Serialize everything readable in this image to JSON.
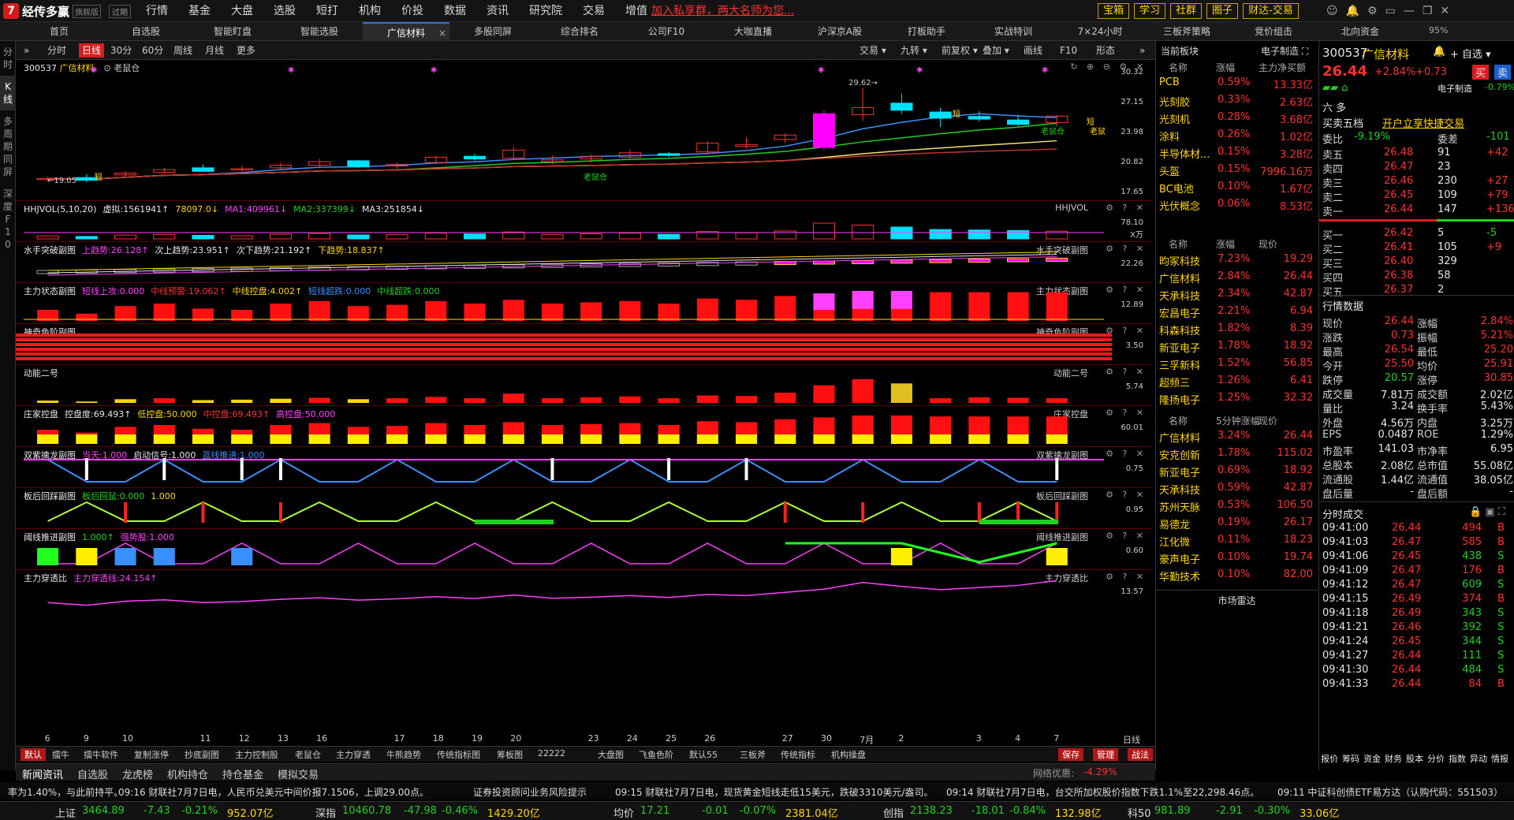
{
  "app": {
    "logo_mark": "7",
    "name": "经传多赢",
    "edition": "旗舰版",
    "expiry": "过期"
  },
  "menu": [
    "行情",
    "基金",
    "大盘",
    "选股",
    "短打",
    "机构",
    "价投",
    "数据",
    "资讯",
    "研究院",
    "交易",
    "增值"
  ],
  "promo": "加入私享群，两大名师为您...",
  "right_buttons": [
    "宝箱",
    "学习",
    "社群",
    "圈子",
    "财达-交易"
  ],
  "window_icons": [
    "☺",
    "🔔",
    "⚙",
    "▭",
    "—",
    "❐",
    "✕"
  ],
  "tabs": [
    "首页",
    "自选股",
    "智能盯盘",
    "智能选股",
    "广信材料",
    "多股同屏",
    "综合排名",
    "公司F10",
    "大咖直播",
    "沪深京A股",
    "打板助手",
    "实战特训",
    "7×24小时",
    "三板斧策略",
    "竞价组击",
    "北向资金"
  ],
  "zoom": "95%",
  "left_side": [
    "分时",
    "K线",
    "多周期同屏",
    "深度F10"
  ],
  "chart_toolbar": {
    "left": [
      "分时",
      "日线",
      "30分",
      "60分",
      "周线",
      "月线",
      "更多"
    ],
    "right": [
      "交易",
      "九转",
      "前复权",
      "叠加",
      "画线",
      "F10",
      "形态"
    ]
  },
  "stock": {
    "code": "300537",
    "name": "广信材料",
    "tag": "老鼠仓"
  },
  "main_chart": {
    "scale": [
      "30.32",
      "27.15",
      "23.98",
      "20.82",
      "17.65"
    ],
    "low_label": "19.05",
    "high_label": "29.62",
    "marks": [
      "短",
      "老鼠仓",
      "短",
      "老鼠仓",
      "短",
      "老鼠"
    ]
  },
  "panes": [
    {
      "name": "HHJVOL",
      "items": [
        [
          "HHJVOL(5,10,20)",
          "w"
        ],
        [
          "虚拟:1561941↑",
          "w"
        ],
        [
          "78097.0↓",
          "y"
        ],
        [
          "MA1:409961↓",
          "m"
        ],
        [
          "MA2:337399↓",
          "g"
        ],
        [
          "MA3:251854↓",
          "w"
        ]
      ],
      "right": "HHJVOL",
      "scale": [
        "78.10",
        "X万"
      ]
    },
    {
      "name": "水手突破副图",
      "items": [
        [
          "水手突破副图",
          "w"
        ],
        [
          "上趋势:26.128↑",
          "m"
        ],
        [
          "次上趋势:23.951↑",
          "w"
        ],
        [
          "次下趋势:21.192↑",
          "w"
        ],
        [
          "下趋势:18.837↑",
          "y"
        ]
      ],
      "right": "水手突破副图",
      "scale": [
        "22.26"
      ]
    },
    {
      "name": "主力状态副图",
      "items": [
        [
          "主力状态副图",
          "w"
        ],
        [
          "短线上攻:0.000",
          "m"
        ],
        [
          "中线预警:19.062↑",
          "r"
        ],
        [
          "中线控盘:4.002↑",
          "y"
        ],
        [
          "短线超跌:0.000",
          "b"
        ],
        [
          "中线超跌:0.000",
          "g"
        ]
      ],
      "right": "主力状态副图",
      "scale": [
        "12.89"
      ]
    },
    {
      "name": "神奇色阶副图",
      "items": [
        [
          "神奇色阶副图",
          "w"
        ]
      ],
      "right": "神奇色阶副图",
      "scale": [
        "3.50"
      ]
    },
    {
      "name": "动能二号",
      "items": [
        [
          "动能二号",
          "w"
        ]
      ],
      "right": "动能二号",
      "scale": [
        "5.74"
      ]
    },
    {
      "name": "庄家控盘",
      "items": [
        [
          "庄家控盘",
          "w"
        ],
        [
          "控盘度:69.493↑",
          "w"
        ],
        [
          "低控盘:50.000",
          "y"
        ],
        [
          "中控盘:69.493↑",
          "r"
        ],
        [
          "高控盘:50.000",
          "m"
        ]
      ],
      "right": "庄家控盘",
      "scale": [
        "60.01"
      ]
    },
    {
      "name": "双紫擒龙副图",
      "items": [
        [
          "双紫擒龙副图",
          "w"
        ],
        [
          "当天:1.000",
          "m"
        ],
        [
          "启动信号:1.000",
          "w"
        ],
        [
          "蓝线推进:1.000",
          "b"
        ]
      ],
      "right": "双紫擒龙副图",
      "scale": [
        "0.75"
      ]
    },
    {
      "name": "板后回踩副图",
      "items": [
        [
          "板后回踩副图",
          "w"
        ],
        [
          "板后回鼠:0.000",
          "g"
        ],
        [
          "1.000",
          "y"
        ]
      ],
      "right": "板后回踩副图",
      "scale": [
        "0.95"
      ]
    },
    {
      "name": "阈线推进副图",
      "items": [
        [
          "阈线推进副图",
          "w"
        ],
        [
          "1.000↑",
          "g"
        ],
        [
          "强势股:1.000",
          "m"
        ]
      ],
      "right": "阈线推进副图",
      "scale": [
        "0.60"
      ]
    },
    {
      "name": "主力穿透比",
      "items": [
        [
          "主力穿透比",
          "w"
        ],
        [
          "主力穿透线:24.154↑",
          "m"
        ]
      ],
      "right": "主力穿透比",
      "scale": [
        "13.57"
      ]
    }
  ],
  "x_axis": [
    "6",
    "9",
    "10",
    "11",
    "12",
    "13",
    "16",
    "17",
    "18",
    "19",
    "20",
    "23",
    "24",
    "25",
    "26",
    "27",
    "30",
    "7月",
    "2",
    "3",
    "4",
    "7"
  ],
  "x_axis_right": "日线",
  "bottom_tabs": [
    "默认",
    "擂牛",
    "擂牛软件",
    "复制涨停",
    "抄底副图",
    "主力控制股",
    "老鼠仓",
    "主力穿透",
    "牛熊趋势",
    "传统指标图",
    "筹板图",
    "22222",
    "大盘图",
    "飞鱼色阶",
    "默认55",
    "三板斧",
    "传统指标",
    "机构操盘"
  ],
  "bottom_right": [
    "保存",
    "管理",
    "战法"
  ],
  "news_tabs": [
    "新闻资讯",
    "自选股",
    "龙虎榜",
    "机构持仓",
    "持仓基金",
    "模拟交易"
  ],
  "network": "网络优惠:",
  "network_val": "-4.29%",
  "ticker": [
    "率为1.40%，与此前持平。",
    "09:16 财联社7月7日电，人民币兑美元中间价报7.1506，上调29.00点。",
    "证券投资顾问业务风险提示",
    "09:15 财联社7月7日电，现货黄金短线走低15美元，跌破3310美元/盎司。",
    "09:14 财联社7月7日电，台交所加权股价指数下跌1.1%至22,298.46点。",
    "09:11 中证科创债ETF易方达（认购代码：551503）"
  ],
  "indices": [
    {
      "name": "上证",
      "val": "3464.89",
      "chg": "-7.43",
      "pct": "-0.21%",
      "amt": "952.07亿"
    },
    {
      "name": "深指",
      "val": "10460.78",
      "chg": "-47.98",
      "pct": "-0.46%",
      "amt": "1429.20亿"
    },
    {
      "name": "均价",
      "val": "17.21",
      "chg": "-0.01",
      "pct": "-0.07%",
      "amt": "2381.04亿"
    },
    {
      "name": "创指",
      "val": "2138.23",
      "chg": "-18.01",
      "pct": "-0.84%",
      "amt": "132.98亿"
    },
    {
      "name": "科50",
      "val": "981.89",
      "chg": "-2.91",
      "pct": "-0.30%",
      "amt": "33.06亿"
    }
  ],
  "sector_block": {
    "title": "当前板块",
    "tag": "电子制造",
    "head": [
      "名称",
      "涨幅",
      "主力净买额"
    ],
    "rows": [
      [
        "PCB",
        "0.59%",
        "13.33亿"
      ],
      [
        "光刻胶",
        "0.33%",
        "2.63亿"
      ],
      [
        "光刻机",
        "0.28%",
        "3.68亿"
      ],
      [
        "涂料",
        "0.26%",
        "1.02亿"
      ],
      [
        "半导体材...",
        "0.15%",
        "3.28亿"
      ],
      [
        "头盔",
        "0.15%",
        "7996.16万"
      ],
      [
        "BC电池",
        "0.10%",
        "1.67亿"
      ],
      [
        "光伏概念",
        "0.06%",
        "8.53亿"
      ]
    ]
  },
  "sector_list2": {
    "head": [
      "名称",
      "涨幅",
      "现价"
    ],
    "rows": [
      [
        "昀冢科技",
        "7.23%",
        "19.29"
      ],
      [
        "广信材料",
        "2.84%",
        "26.44"
      ],
      [
        "天承科技",
        "2.34%",
        "42.87"
      ],
      [
        "宏昌电子",
        "2.21%",
        "6.94"
      ],
      [
        "科森科技",
        "1.82%",
        "8.39"
      ],
      [
        "新亚电子",
        "1.78%",
        "18.92"
      ],
      [
        "三孚新科",
        "1.52%",
        "56.85"
      ],
      [
        "超频三",
        "1.26%",
        "6.41"
      ],
      [
        "隆扬电子",
        "1.25%",
        "32.32"
      ]
    ]
  },
  "sector_list3": {
    "head": [
      "名称",
      "5分钟涨幅",
      "现价"
    ],
    "rows": [
      [
        "广信材料",
        "3.24%",
        "26.44"
      ],
      [
        "安克创新",
        "1.78%",
        "115.02"
      ],
      [
        "新亚电子",
        "0.69%",
        "18.92"
      ],
      [
        "天承科技",
        "0.59%",
        "42.87"
      ],
      [
        "苏州天脉",
        "0.53%",
        "106.50"
      ],
      [
        "易德龙",
        "0.19%",
        "26.17"
      ],
      [
        "江化微",
        "0.11%",
        "18.23"
      ],
      [
        "豪声电子",
        "0.10%",
        "19.74"
      ],
      [
        "华勤技术",
        "0.10%",
        "82.00"
      ]
    ]
  },
  "sector_footer": "市场雷达",
  "quote": {
    "code": "300537",
    "name": "广信材料",
    "price": "26.44",
    "pct": "+2.84%",
    "chg": "+0.73",
    "sector": "电子制造",
    "sector_pct": "-0.79%",
    "buy_btn": "买",
    "sell_btn": "卖",
    "watch_btn": "自选",
    "five_title": "买卖五档",
    "trade_link": "开户立享快捷交易",
    "wb_label": "委比",
    "wb_val": "-9.19%",
    "wc_label": "委差",
    "wc_val": "-101",
    "asks": [
      [
        "卖五",
        "26.48",
        "91",
        "+42"
      ],
      [
        "卖四",
        "26.47",
        "23",
        ""
      ],
      [
        "卖三",
        "26.46",
        "230",
        "+27"
      ],
      [
        "卖二",
        "26.45",
        "109",
        "+79"
      ],
      [
        "卖一",
        "26.44",
        "147",
        "+136"
      ]
    ],
    "bids": [
      [
        "买一",
        "26.42",
        "5",
        "-5"
      ],
      [
        "买二",
        "26.41",
        "105",
        "+9"
      ],
      [
        "买三",
        "26.40",
        "329",
        ""
      ],
      [
        "买四",
        "26.38",
        "58",
        ""
      ],
      [
        "买五",
        "26.37",
        "2",
        ""
      ]
    ],
    "data_title": "行情数据",
    "stats": [
      [
        "现价",
        "26.44",
        "涨幅",
        "2.84%"
      ],
      [
        "涨跌",
        "0.73",
        "振幅",
        "5.21%"
      ],
      [
        "最高",
        "26.54",
        "最低",
        "25.20"
      ],
      [
        "今开",
        "25.50",
        "均价",
        "25.91"
      ],
      [
        "跌停",
        "20.57",
        "涨停",
        "30.85"
      ],
      [
        "成交量",
        "7.81万",
        "成交额",
        "2.02亿"
      ],
      [
        "量比",
        "3.24",
        "换手率",
        "5.43%"
      ],
      [
        "外盘",
        "4.56万",
        "内盘",
        "3.25万"
      ],
      [
        "EPS",
        "0.0487",
        "ROE",
        "1.29%"
      ],
      [
        "市盈率",
        "141.03",
        "市净率",
        "6.95"
      ],
      [
        "总股本",
        "2.08亿",
        "总市值",
        "55.08亿"
      ],
      [
        "流通股",
        "1.44亿",
        "流通值",
        "38.05亿"
      ],
      [
        "盘后量",
        "-",
        "盘后额",
        "-"
      ]
    ],
    "ticks_title": "分时成交",
    "ticks": [
      [
        "09:41:00",
        "26.44",
        "494",
        "B"
      ],
      [
        "09:41:03",
        "26.47",
        "585",
        "B"
      ],
      [
        "09:41:06",
        "26.45",
        "438",
        "S"
      ],
      [
        "09:41:09",
        "26.47",
        "176",
        "B"
      ],
      [
        "09:41:12",
        "26.47",
        "609",
        "S"
      ],
      [
        "09:41:15",
        "26.49",
        "374",
        "B"
      ],
      [
        "09:41:18",
        "26.49",
        "343",
        "S"
      ],
      [
        "09:41:21",
        "26.46",
        "392",
        "S"
      ],
      [
        "09:41:24",
        "26.45",
        "344",
        "S"
      ],
      [
        "09:41:27",
        "26.44",
        "111",
        "S"
      ],
      [
        "09:41:30",
        "26.44",
        "484",
        "S"
      ],
      [
        "09:41:33",
        "26.44",
        "84",
        "B"
      ]
    ],
    "footer_tabs": [
      "报价",
      "筹码",
      "资金",
      "财务",
      "股本",
      "分价",
      "指数",
      "异动",
      "情报"
    ]
  },
  "candles": [
    [
      19.3,
      19.6,
      19.1,
      19.4
    ],
    [
      19.5,
      19.9,
      19.0,
      19.2
    ],
    [
      19.8,
      20.2,
      19.6,
      20.0
    ],
    [
      20.1,
      20.6,
      19.9,
      20.4
    ],
    [
      20.6,
      21.0,
      20.3,
      20.2
    ],
    [
      20.5,
      20.8,
      20.2,
      20.5
    ],
    [
      20.6,
      21.2,
      20.4,
      20.9
    ],
    [
      20.9,
      21.6,
      20.7,
      21.3
    ],
    [
      21.4,
      21.5,
      20.6,
      20.7
    ],
    [
      20.8,
      21.2,
      20.5,
      21.0
    ],
    [
      21.2,
      22.0,
      21.0,
      21.8
    ],
    [
      21.9,
      22.2,
      21.4,
      21.6
    ],
    [
      21.7,
      23.0,
      21.5,
      22.6
    ],
    [
      21.3,
      22.0,
      21.0,
      21.5
    ],
    [
      21.6,
      22.1,
      21.2,
      21.9
    ],
    [
      21.8,
      22.6,
      21.5,
      22.3
    ],
    [
      22.2,
      22.4,
      21.8,
      22.0
    ],
    [
      22.4,
      23.6,
      22.1,
      23.4
    ],
    [
      23.0,
      24.0,
      22.8,
      23.2
    ],
    [
      23.8,
      24.5,
      23.4,
      24.3
    ],
    [
      22.9,
      27.1,
      22.6,
      26.7
    ],
    [
      26.6,
      29.62,
      25.9,
      27.4
    ],
    [
      27.9,
      29.0,
      26.7,
      27.1
    ],
    [
      26.9,
      27.4,
      25.2,
      26.2
    ],
    [
      26.4,
      27.0,
      25.8,
      26.1
    ],
    [
      26.0,
      26.6,
      25.3,
      25.5
    ],
    [
      25.7,
      26.54,
      25.2,
      26.44
    ]
  ],
  "chart_ylim": [
    17.65,
    31.0
  ],
  "vol": [
    30,
    25,
    38,
    45,
    36,
    32,
    48,
    55,
    40,
    42,
    60,
    50,
    70,
    45,
    52,
    58,
    46,
    75,
    62,
    80,
    160,
    140,
    120,
    95,
    90,
    85,
    78
  ],
  "dong": [
    0.5,
    0.3,
    0.8,
    1.0,
    0.6,
    0.7,
    0.9,
    1.1,
    0.8,
    1.0,
    1.3,
    1.0,
    2.0,
    1.0,
    1.2,
    1.4,
    1.0,
    1.6,
    1.5,
    2.2,
    3.8,
    5.1,
    4.2,
    1.0,
    1.2,
    1.1,
    1.0
  ],
  "zj_red": [
    55,
    52,
    58,
    60,
    56,
    55,
    60,
    62,
    58,
    59,
    62,
    60,
    63,
    60,
    61,
    62,
    60,
    64,
    63,
    66,
    68,
    70,
    70,
    69,
    69,
    69,
    69
  ],
  "chuantou": [
    16,
    15,
    16.5,
    17,
    16,
    16.4,
    17.2,
    17.8,
    16.9,
    17.4,
    18.2,
    17.5,
    18.8,
    17.6,
    18,
    18.6,
    17.9,
    19,
    18.6,
    19.8,
    21,
    23.5,
    22,
    20.8,
    21.6,
    22.4,
    24.2
  ]
}
